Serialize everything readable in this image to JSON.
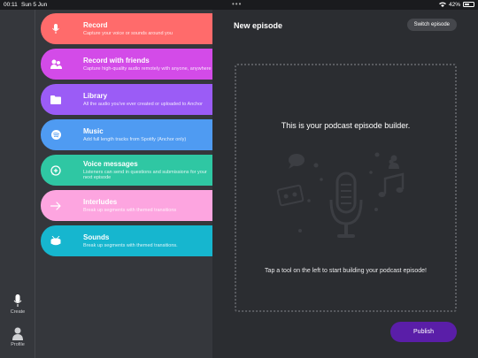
{
  "status_bar": {
    "time": "00:11",
    "date": "Sun 5 Jun",
    "battery": "42%",
    "battery_level": 0.42
  },
  "rail": {
    "create_label": "Create",
    "profile_label": "Profile"
  },
  "tools": [
    {
      "title": "Record",
      "desc": "Capture your voice or sounds around you",
      "color": "#ff6b6b",
      "icon": "microphone-icon"
    },
    {
      "title": "Record with friends",
      "desc": "Capture high-quality audio remotely with anyone, anywhere",
      "color": "#d34be8",
      "icon": "friends-icon"
    },
    {
      "title": "Library",
      "desc": "All the audio you've ever created or uploaded to Anchor",
      "color": "#9b5cf6",
      "icon": "folder-icon"
    },
    {
      "title": "Music",
      "desc": "Add full length tracks from Spotify (Anchor only)",
      "color": "#4f9bf2",
      "icon": "spotify-icon"
    },
    {
      "title": "Voice messages",
      "desc": "Listeners can send in questions and submissions for your next episode",
      "color": "#2fc7a3",
      "icon": "voice-message-icon"
    },
    {
      "title": "Interludes",
      "desc": "Break up segments with themed transitions",
      "color": "#fda5e0",
      "icon": "arrow-right-icon"
    },
    {
      "title": "Sounds",
      "desc": "Break up segments with themed transitions.",
      "color": "#16b6cf",
      "icon": "drum-icon"
    }
  ],
  "main": {
    "title": "New episode",
    "switch_label": "Switch episode",
    "builder_heading": "This is your podcast episode builder.",
    "builder_hint": "Tap a tool on the left to start building your podcast episode!",
    "publish_label": "Publish"
  }
}
